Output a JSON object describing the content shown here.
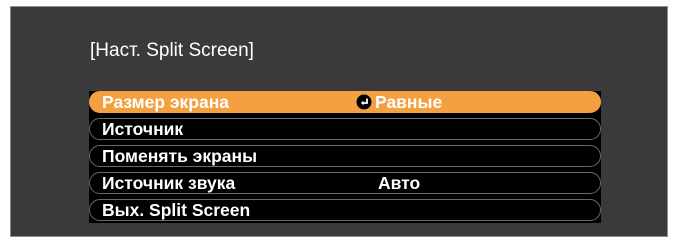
{
  "menu": {
    "title": "[Наст. Split Screen]",
    "colors": {
      "panel_background": "#3a3a3a",
      "item_background": "#000000",
      "selection": "#f5a040",
      "text": "#ffffff"
    },
    "items": [
      {
        "label": "Размер экрана",
        "value": "Равные",
        "selected": true,
        "value_icon": "enter-icon"
      },
      {
        "label": "Источник",
        "value": ""
      },
      {
        "label": "Поменять экраны",
        "value": ""
      },
      {
        "label": "Источник звука",
        "value": "Авто"
      },
      {
        "label": "Вых. Split Screen",
        "value": ""
      }
    ]
  }
}
